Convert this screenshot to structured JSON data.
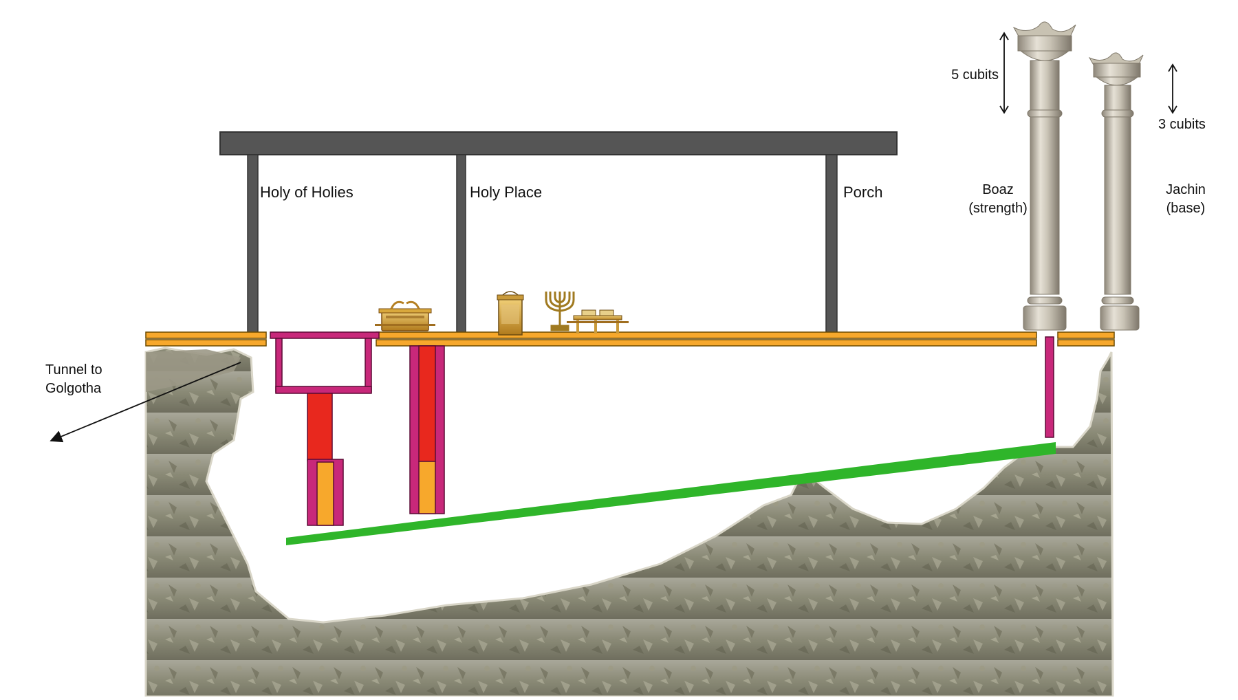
{
  "labels": {
    "tunnel_line1": "Tunnel to",
    "tunnel_line2": "Golgotha",
    "holy_of_holies": "Holy of Holies",
    "holy_place": "Holy Place",
    "porch": "Porch",
    "boaz_line1": "Boaz",
    "boaz_line2": "(strength)",
    "jachin_line1": "Jachin",
    "jachin_line2": "(base)",
    "boaz_capital": "5 cubits",
    "jachin_capital": "3 cubits"
  },
  "colors": {
    "roof": "#555555",
    "floor": "#f7a82c",
    "magenta": "#c8287a",
    "red": "#e8281e",
    "orange": "#f7a82c",
    "green": "#2fb52a",
    "rock": "#8a8a78",
    "pillar": "#b8b2a4"
  },
  "icons": [
    "ark-of-covenant-icon",
    "altar-of-incense-icon",
    "menorah-icon",
    "table-of-showbread-icon"
  ]
}
